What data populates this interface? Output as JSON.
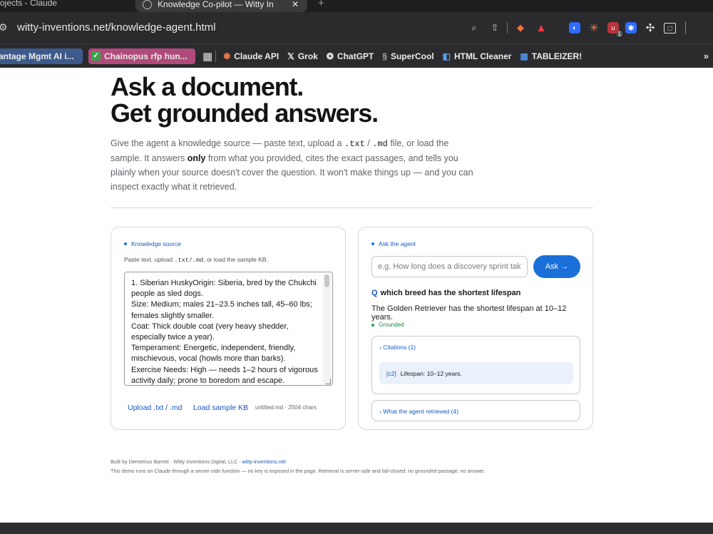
{
  "browser": {
    "prev_tab_title": "ojects - Claude",
    "active_tab_title": "Knowledge Co-pilot — Witty In",
    "close_glyph": "✕",
    "new_tab_glyph": "+",
    "url": "witty-inventions.net/knowledge-agent.html"
  },
  "bookmarks": [
    {
      "label": "antage Mgmt AI i..."
    },
    {
      "label": "Chainopus rfp hun..."
    },
    {
      "label": "Claude API"
    },
    {
      "label": "Grok"
    },
    {
      "label": "ChatGPT"
    },
    {
      "label": "SuperCool"
    },
    {
      "label": "HTML Cleaner"
    },
    {
      "label": "TABLEIZER!"
    }
  ],
  "bookmarks_more": "»",
  "hero": {
    "title_line1": "Ask a document.",
    "title_line2": "Get grounded answers."
  },
  "lede": {
    "p1": "Give the agent a knowledge source — paste text, upload a ",
    "code1": ".txt",
    "sep": " / ",
    "code2": ".md",
    "p2": " file, or load the sample. It answers ",
    "bold": "only",
    "p3": " from what you provided, cites the exact passages, and tells you plainly when your source doesn't cover the question. It won't make things up — and you can inspect exactly what it retrieved."
  },
  "knowledge": {
    "label": "Knowledge source",
    "hint_pre": "Paste text, upload ",
    "hint_code": ".txt/.md",
    "hint_post": ", or load the sample KB.",
    "text": "1. Siberian HuskyOrigin: Siberia, bred by the Chukchi people as sled dogs.\nSize: Medium; males 21–23.5 inches tall, 45–60 lbs; females slightly smaller.\nCoat: Thick double coat (very heavy shedder, especially twice a year).\nTemperament: Energetic, independent, friendly, mischievous, vocal (howls more than barks).\nExercise Needs: High — needs 1–2 hours of vigorous activity daily; prone to boredom and escape.",
    "upload_label": "Upload .txt / .md",
    "load_label": "Load sample KB",
    "file_info": "untitled.md · 2504 chars"
  },
  "agent": {
    "label": "Ask the agent",
    "placeholder": "e.g. How long does a discovery sprint take?",
    "ask_label": "Ask →",
    "q_marker": "Q",
    "question": "which breed has the shortest lifespan",
    "answer": "The Golden Retriever has the shortest lifespan at 10–12 years.",
    "status": "Grounded",
    "citations_summary": "› Citations (1)",
    "citation_id": "[c2]",
    "citation_text": "Lifespan: 10–12 years.",
    "retrieved_summary": "› What the agent retrieved (4)"
  },
  "footer": {
    "line1_pre": "Built by Demetrius Barrett · Witty Inventions Digital, LLC · ",
    "line1_link": "witty-inventions.net",
    "line2": "This demo runs on Claude through a server-side function — no key is exposed in the page. Retrieval is server-side and fail-closed: no grounded passage, no answer."
  },
  "colors": {
    "accent": "#1a6fd9",
    "link": "#1558c4",
    "grounded": "#1fa34a"
  }
}
